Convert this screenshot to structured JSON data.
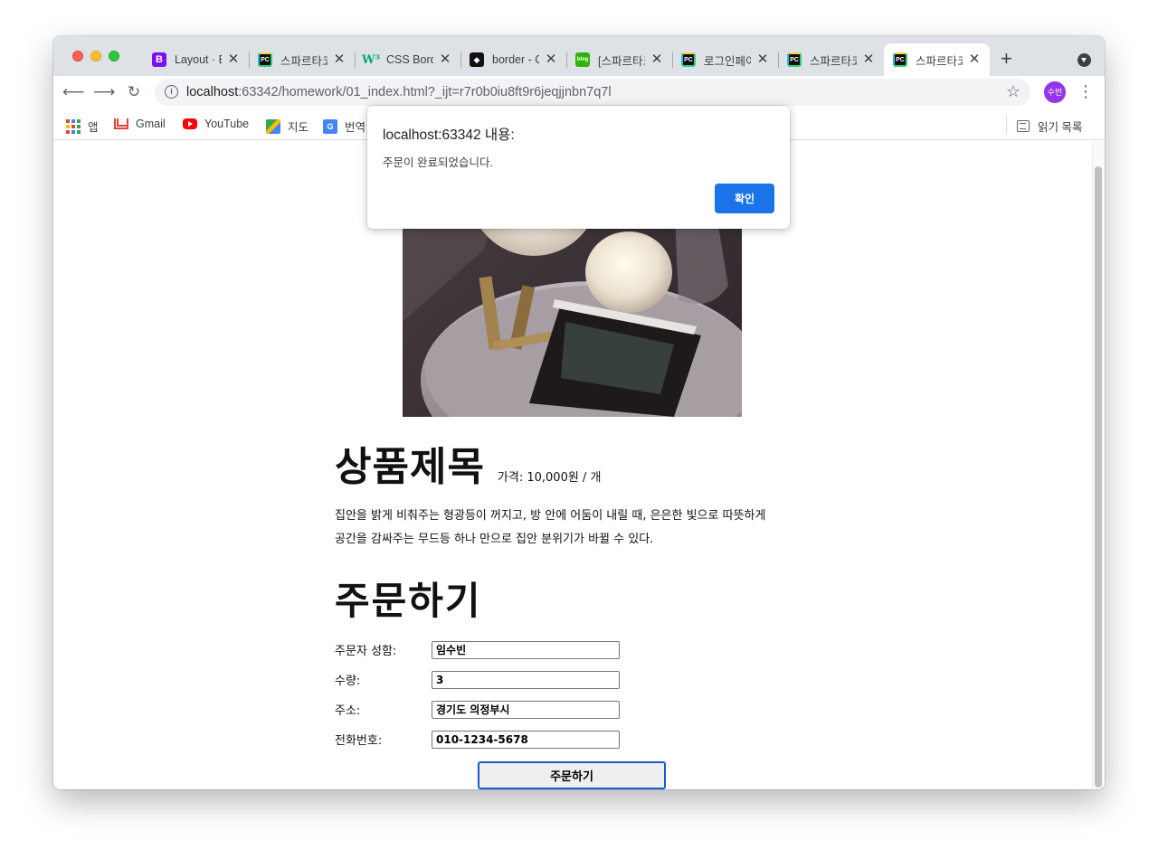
{
  "browser": {
    "tabs": [
      {
        "title": "Layout · Bootstrap",
        "favicon": "bootstrap-icon",
        "active": false
      },
      {
        "title": "스파르타코딩",
        "favicon": "pycharm-icon",
        "active": false
      },
      {
        "title": "CSS Borders",
        "favicon": "w3schools-icon",
        "active": false
      },
      {
        "title": "border - CSS",
        "favicon": "border-icon",
        "active": false
      },
      {
        "title": "[스파르타코딩",
        "favicon": "blog-icon",
        "active": false
      },
      {
        "title": "로그인페이지",
        "favicon": "pycharm-icon",
        "active": false
      },
      {
        "title": "스파르타코딩",
        "favicon": "pycharm-icon",
        "active": false
      },
      {
        "title": "스파르타코딩",
        "favicon": "pycharm-icon",
        "active": true
      }
    ],
    "tab_close_glyph": "✕",
    "new_tab_glyph": "+",
    "address": {
      "host": "localhost",
      "path": ":63342/homework/01_index.html?_ijt=r7r0b0iu8ft9r6jeqjjnbn7q7l"
    },
    "profile_initials": "수빈",
    "bookmarks": [
      {
        "label": "앱",
        "icon": "apps-icon"
      },
      {
        "label": "Gmail",
        "icon": "gmail-icon"
      },
      {
        "label": "YouTube",
        "icon": "youtube-icon"
      },
      {
        "label": "지도",
        "icon": "maps-icon"
      },
      {
        "label": "번역",
        "icon": "translate-icon"
      }
    ],
    "reading_list": "읽기 목록",
    "colors": {
      "tabstrip": "#dee1e6",
      "accent": "#1a73e8",
      "profile": "#9334e6"
    }
  },
  "dialog": {
    "title": "localhost:63342 내용:",
    "message": "주문이 완료되었습니다.",
    "ok_label": "확인"
  },
  "page": {
    "product_title": "상품제목",
    "price": "가격: 10,000원 / 개",
    "description_line1": "집안을 밝게 비춰주는 형광등이 꺼지고, 방 안에 어둠이 내릴 때, 은은한 빛으로 따뜻하게",
    "description_line2": "공간을 감싸주는 무드등 하나 만으로 집안 분위기가 바뀔 수 있다.",
    "order_title": "주문하기",
    "form": [
      {
        "label": "주문자 성함:",
        "value": "임수빈"
      },
      {
        "label": "수량:",
        "value": "3"
      },
      {
        "label": "주소:",
        "value": "경기도 의정부시"
      },
      {
        "label": "전화번호:",
        "value": "010-1234-5678"
      }
    ],
    "submit_label": "주문하기"
  }
}
